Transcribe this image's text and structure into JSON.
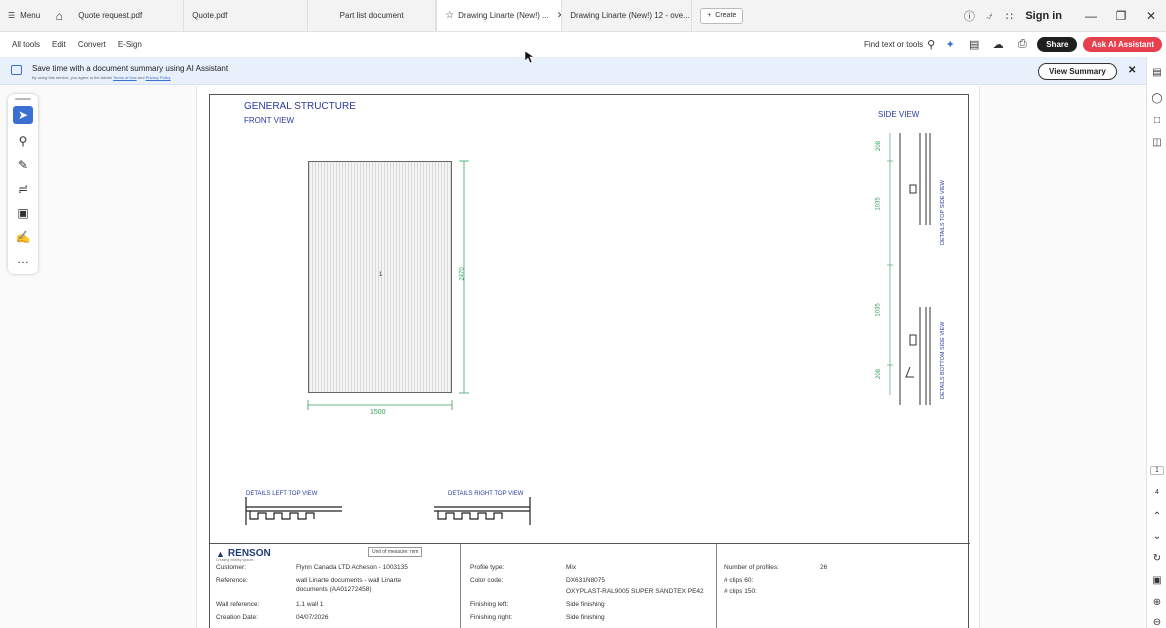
{
  "tabbar": {
    "menu_label": "Menu",
    "tabs": [
      {
        "label": "Quote request.pdf"
      },
      {
        "label": "Quote.pdf"
      },
      {
        "label": "Part list document"
      },
      {
        "label": "Drawing Linarte (New!) ..."
      },
      {
        "label": "Drawing Linarte (New!) 12 - ove..."
      }
    ],
    "create_label": "Create",
    "signin_label": "Sign in"
  },
  "toolbar": {
    "items": [
      "All tools",
      "Edit",
      "Convert",
      "E-Sign"
    ],
    "find_label": "Find text or tools",
    "share_label": "Share",
    "ai_label": "Ask AI Assistant"
  },
  "banner": {
    "text": "Save time with a document summary using AI Assistant",
    "subtext_prefix": "By using this service, you agree to the Adobe",
    "terms_link": "Terms of Use",
    "and": "and",
    "privacy_link": "Privacy Policy",
    "view_summary_label": "View Summary"
  },
  "rightrail": {
    "page_current": "1",
    "page_total": "4"
  },
  "drawing": {
    "title": "GENERAL STRUCTURE",
    "front_view": "FRONT VIEW",
    "side_view": "SIDE VIEW",
    "panel_number": "1",
    "height_dim": "2470",
    "width_dim": "1500",
    "side_dims": [
      "208",
      "1035",
      "1035",
      "208"
    ],
    "details_top_side": "DETAILS TOP SIDE VIEW",
    "details_bottom_side": "DETAILS BOTTOM SIDE VIEW",
    "details_left_top": "DETAILS LEFT TOP VIEW",
    "details_right_top": "DETAILS RIGHT TOP VIEW"
  },
  "titleblock": {
    "logo": "RENSON",
    "logo_tagline": "Creating healthy spaces",
    "unit_of_measure": "Unit of measure: mm",
    "col1": [
      {
        "label": "Customer:",
        "value": "Flynn Canada LTD Acheson - 1003135"
      },
      {
        "label": "Reference:",
        "value": "wall Linarte documents - wall Linarte"
      },
      {
        "label": "",
        "value": "documents (AA01272458)"
      },
      {
        "label": "Wall reference:",
        "value": "1.1 wall 1"
      },
      {
        "label": "Creation Date:",
        "value": "04/07/2026"
      }
    ],
    "col2": [
      {
        "label": "Profile type:",
        "value": "Mix"
      },
      {
        "label": "Color code:",
        "value": "DX631N8075"
      },
      {
        "label": "",
        "value": "OXYPLAST-RAL9005 SUPER SANDTEX PE42"
      },
      {
        "label": "Finishing left:",
        "value": "Side finishing"
      },
      {
        "label": "Finishing right:",
        "value": "Side finishing"
      }
    ],
    "col3": [
      {
        "label": "Number of profiles:",
        "value": "26"
      },
      {
        "label": "# clips 60:",
        "value": ""
      },
      {
        "label": "# clips 150:",
        "value": ""
      }
    ]
  }
}
